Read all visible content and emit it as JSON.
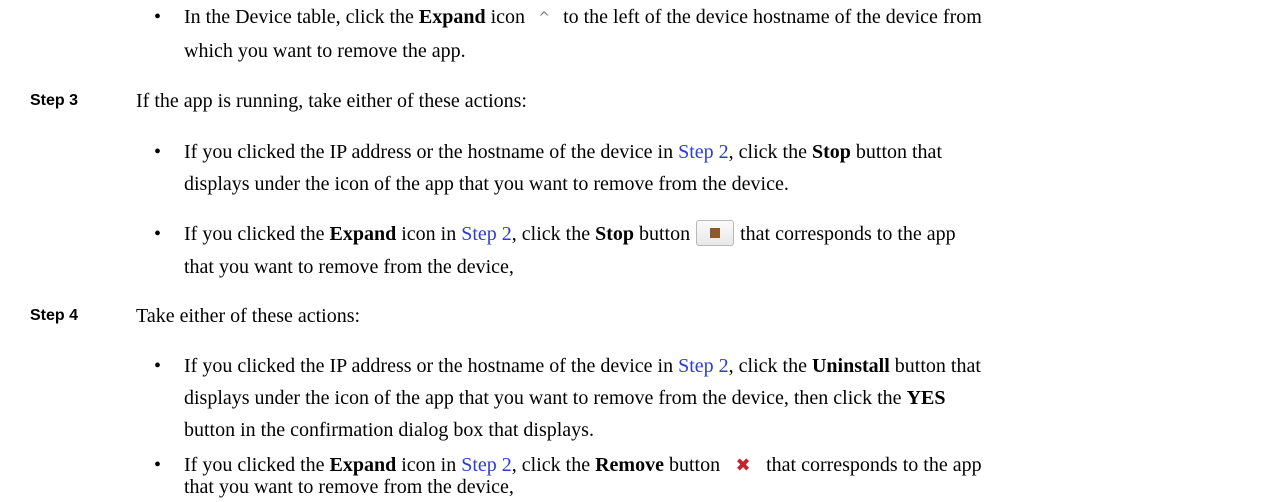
{
  "bullet_char": "•",
  "intro_bullet": {
    "t1": "In the Device table, click the ",
    "b1": "Expand",
    "t2": " icon ",
    "t3": " to the left of the device hostname of the device from",
    "line2": "which you want to remove the app."
  },
  "icons": {
    "expand": "^",
    "expand_name": "chevron-up-icon",
    "stop_name": "stop-square-icon",
    "remove_glyph": "✖",
    "remove_name": "remove-x-icon",
    "stop_color": "#8b5a2b",
    "remove_color": "#c8222c",
    "link_color": "#2b3bd6"
  },
  "step3": {
    "label": "Step 3",
    "text": "If the app is running, take either of these actions:",
    "b1": {
      "t1": "If you clicked the IP address or the hostname of the device in ",
      "link": "Step 2",
      "t2": ", click the ",
      "bold": "Stop",
      "t3": " button that",
      "line2": "displays under the icon of the app that you want to remove from the device."
    },
    "b2": {
      "t1": "If you clicked the ",
      "bold1": "Expand",
      "t2": " icon in ",
      "link": "Step 2",
      "t3": ", click the ",
      "bold2": "Stop",
      "t4": " button",
      "t5": "that corresponds to the app",
      "line2": "that you want to remove from the device,"
    }
  },
  "step4": {
    "label": "Step 4",
    "text": "Take either of these actions:",
    "b1": {
      "t1": "If you clicked the IP address or the hostname of the device in ",
      "link": "Step 2",
      "t2": ", click the ",
      "bold": "Uninstall",
      "t3": " button that",
      "line2a": "displays under the icon of the app that you want to remove from the device, then click the ",
      "bold2": "YES",
      "line3": "button in the confirmation dialog box that displays."
    },
    "b2": {
      "t1": "If you clicked the ",
      "bold1": "Expand",
      "t2": " icon in ",
      "link": "Step 2",
      "t3": ", click the ",
      "bold2": "Remove",
      "t4": " button",
      "t5": "that corresponds to the app",
      "line2": "that you want to remove from the device,"
    }
  }
}
